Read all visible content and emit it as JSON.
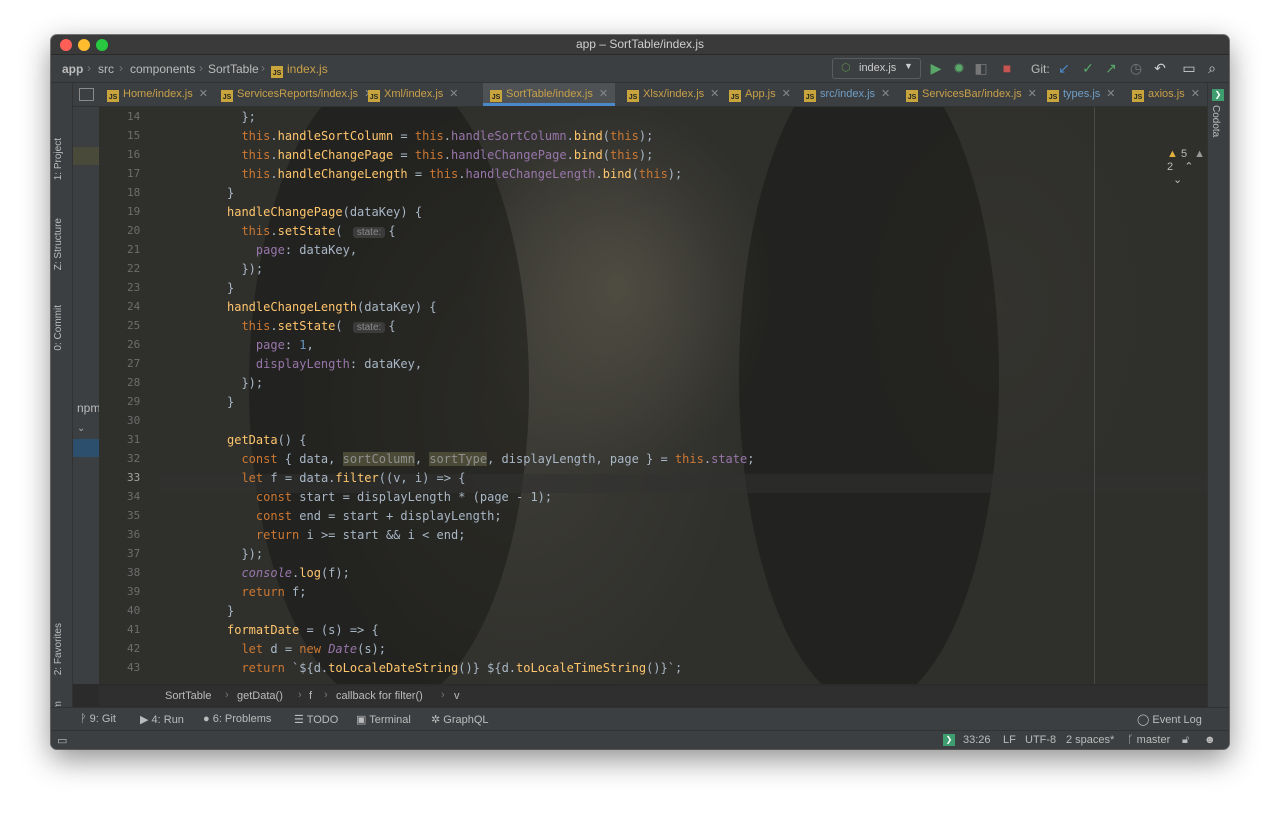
{
  "window": {
    "title": "app – SortTable/index.js"
  },
  "navbar": {
    "breadcrumbs": [
      "app",
      "src",
      "components",
      "SortTable",
      "index.js"
    ],
    "run_config": "index.js",
    "git_label": "Git:"
  },
  "tabs": [
    {
      "label": "Home/index.js"
    },
    {
      "label": "ServicesReports/index.js"
    },
    {
      "label": "Xml/index.js"
    },
    {
      "label": "SortTable/index.js",
      "active": true
    },
    {
      "label": "Xlsx/index.js"
    },
    {
      "label": "App.js"
    },
    {
      "label": "src/index.js"
    },
    {
      "label": "ServicesBar/index.js"
    },
    {
      "label": "types.js"
    },
    {
      "label": "axios.js"
    }
  ],
  "left_tool_windows": [
    "1: Project",
    "Z: Structure",
    "0: Commit",
    "2: Favorites",
    "npm"
  ],
  "right_tool_windows": [
    "Codota"
  ],
  "project_panel": {
    "npm_label": "npm"
  },
  "inspections": {
    "warnings": "5",
    "weak_warnings": "2"
  },
  "editor": {
    "current_line": "33",
    "lines": [
      {
        "n": "14",
        "code": "  };"
      },
      {
        "n": "15",
        "code": "  this.handleSortColumn = this.handleSortColumn.bind(this);"
      },
      {
        "n": "16",
        "code": "  this.handleChangePage = this.handleChangePage.bind(this);"
      },
      {
        "n": "17",
        "code": "  this.handleChangeLength = this.handleChangeLength.bind(this);"
      },
      {
        "n": "18",
        "code": "}"
      },
      {
        "n": "19",
        "code": "handleChangePage(dataKey) {"
      },
      {
        "n": "20",
        "code": "  this.setState( state: {"
      },
      {
        "n": "21",
        "code": "    page: dataKey,"
      },
      {
        "n": "22",
        "code": "  });"
      },
      {
        "n": "23",
        "code": "}"
      },
      {
        "n": "24",
        "code": "handleChangeLength(dataKey) {"
      },
      {
        "n": "25",
        "code": "  this.setState( state: {"
      },
      {
        "n": "26",
        "code": "    page: 1,"
      },
      {
        "n": "27",
        "code": "    displayLength: dataKey,"
      },
      {
        "n": "28",
        "code": "  });"
      },
      {
        "n": "29",
        "code": "}"
      },
      {
        "n": "30",
        "code": ""
      },
      {
        "n": "31",
        "code": "getData() {"
      },
      {
        "n": "32",
        "code": "  const { data, sortColumn, sortType, displayLength, page } = this.state;"
      },
      {
        "n": "33",
        "code": "  let f = data.filter((v, i) => {"
      },
      {
        "n": "34",
        "code": "    const start = displayLength * (page - 1);"
      },
      {
        "n": "35",
        "code": "    const end = start + displayLength;"
      },
      {
        "n": "36",
        "code": "    return i >= start && i < end;"
      },
      {
        "n": "37",
        "code": "  });"
      },
      {
        "n": "38",
        "code": "  console.log(f);"
      },
      {
        "n": "39",
        "code": "  return f;"
      },
      {
        "n": "40",
        "code": "}"
      },
      {
        "n": "41",
        "code": "formatDate = (s) => {"
      },
      {
        "n": "42",
        "code": "  let d = new Date(s);"
      },
      {
        "n": "43",
        "code": "  return `${d.toLocaleDateString()} ${d.toLocaleTimeString()}`;"
      }
    ]
  },
  "code_breadcrumb": [
    "SortTable",
    "getData()",
    "f",
    "callback for filter()",
    "v"
  ],
  "bottom_tools": {
    "git": "9: Git",
    "run": "4: Run",
    "problems": "6: Problems",
    "todo": "TODO",
    "terminal": "Terminal",
    "graphql": "GraphQL",
    "event_log": "Event Log"
  },
  "status": {
    "position": "33:26",
    "line_sep": "LF",
    "encoding": "UTF-8",
    "indent": "2 spaces*",
    "branch": "master"
  },
  "colors": {
    "keyword": "#cc7832",
    "function": "#ffc66d",
    "property": "#9876aa",
    "number": "#6897bb",
    "default_text": "#a9b7c6",
    "active_tab_underline": "#4a88c7"
  }
}
